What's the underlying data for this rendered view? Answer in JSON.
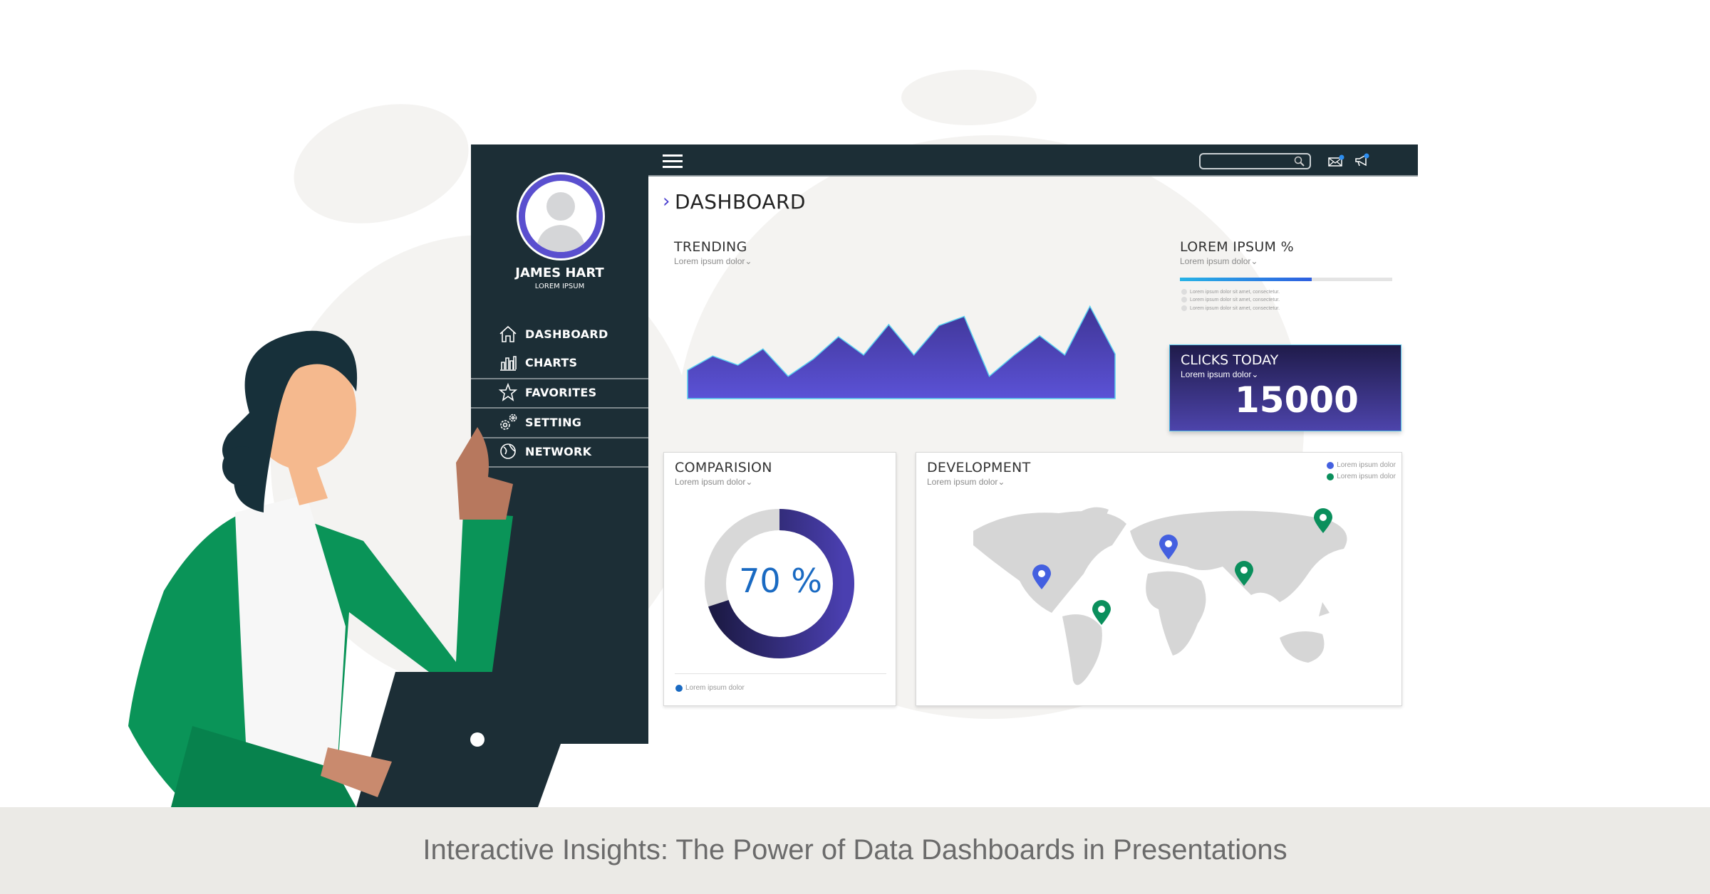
{
  "user": {
    "name": "JAMES HART",
    "role": "LOREM IPSUM"
  },
  "sidebar": {
    "items": [
      {
        "label": "DASHBOARD",
        "icon": "home-icon"
      },
      {
        "label": "CHARTS",
        "icon": "bar-chart-icon"
      },
      {
        "label": "FAVORITES",
        "icon": "star-icon"
      },
      {
        "label": "SETTING",
        "icon": "gear-icon"
      },
      {
        "label": "NETWORK",
        "icon": "globe-icon"
      }
    ]
  },
  "topbar": {
    "search_value": "",
    "icons": [
      "menu-icon",
      "search-icon",
      "mail-icon",
      "megaphone-icon"
    ]
  },
  "page_title": "DASHBOARD",
  "trending": {
    "title": "TRENDING",
    "subtitle": "Lorem ipsum dolor⌄"
  },
  "progress": {
    "title": "LOREM IPSUM %",
    "subtitle": "Lorem ipsum dolor⌄",
    "percent": 62,
    "bullets": [
      "Lorem ipsum dolor sit amet, consectetur.",
      "Lorem ipsum dolor sit amet, consectetur.",
      "Lorem ipsum dolor sit amet, consectetur."
    ]
  },
  "clicks": {
    "title": "CLICKS TODAY",
    "subtitle": "Lorem ipsum dolor⌄",
    "value": "15000"
  },
  "comparison": {
    "title": "COMPARISION",
    "subtitle": "Lorem ipsum dolor⌄",
    "value_label": "70 %",
    "percent": 70,
    "legend": "Lorem ipsum dolor"
  },
  "development": {
    "title": "DEVELOPMENT",
    "subtitle": "Lorem ipsum dolor⌄",
    "legend": [
      {
        "label": "Lorem ipsum dolor",
        "color": "#4460e0"
      },
      {
        "label": "Lorem ipsum dolor",
        "color": "#0a8f5c"
      }
    ]
  },
  "caption": "Interactive Insights: The Power of Data Dashboards in Presentations",
  "colors": {
    "sidebar": "#1c2e36",
    "accent": "#5a4fcf",
    "navy": "#221c4e",
    "green": "#0a9458",
    "blue": "#1a6ac2"
  },
  "chart_data": {
    "type": "area",
    "values": [
      28,
      42,
      33,
      49,
      22,
      39,
      61,
      43,
      73,
      43,
      72,
      81,
      22,
      43,
      62,
      43,
      91,
      44
    ]
  }
}
